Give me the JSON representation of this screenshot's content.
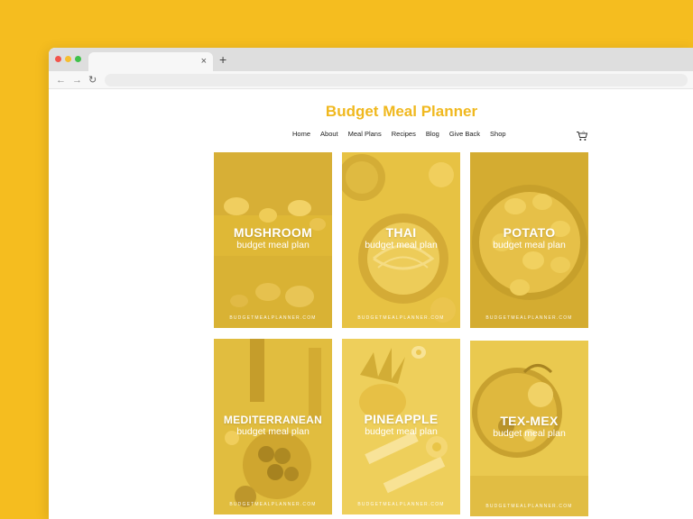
{
  "browser": {
    "tab_close": "×",
    "new_tab": "+",
    "back": "←",
    "forward": "→",
    "reload": "↻"
  },
  "site": {
    "title": "Budget Meal Planner",
    "menu": [
      "Home",
      "About",
      "Meal Plans",
      "Recipes",
      "Blog",
      "Give Back",
      "Shop"
    ],
    "cart_icon": "cart-icon"
  },
  "cards": [
    {
      "title": "MUSHROOM",
      "subtitle": "budget meal plan",
      "footer": "BUDGETMEALPLANNER.COM"
    },
    {
      "title": "THAI",
      "subtitle": "budget meal plan",
      "footer": "BUDGETMEALPLANNER.COM"
    },
    {
      "title": "POTATO",
      "subtitle": "budget meal plan",
      "footer": "BUDGETMEALPLANNER.COM"
    },
    {
      "title": "MEDITERRANEAN",
      "subtitle": "budget meal plan",
      "footer": "BUDGETMEALPLANNER.COM"
    },
    {
      "title": "PINEAPPLE",
      "subtitle": "budget meal plan",
      "footer": "BUDGETMEALPLANNER.COM"
    },
    {
      "title": "TEX-MEX",
      "subtitle": "budget meal plan",
      "footer": "BUDGETMEALPLANNER.COM"
    }
  ],
  "colors": {
    "background": "#f5bd1f",
    "brand": "#f0b81e",
    "card_tint": "#d8b232"
  }
}
